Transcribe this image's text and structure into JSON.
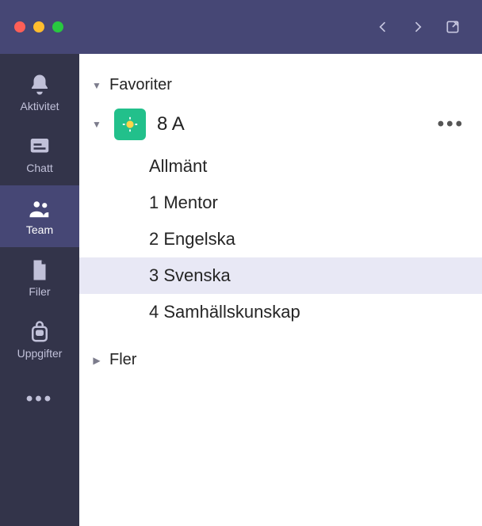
{
  "titlebar": {},
  "rail": {
    "items": [
      {
        "label": "Aktivitet"
      },
      {
        "label": "Chatt"
      },
      {
        "label": "Team"
      },
      {
        "label": "Filer"
      },
      {
        "label": "Uppgifter"
      }
    ]
  },
  "panel": {
    "sections": {
      "favorites": {
        "label": "Favoriter"
      },
      "more": {
        "label": "Fler"
      }
    },
    "team": {
      "name": "8 A",
      "channels": [
        {
          "label": "Allmänt"
        },
        {
          "label": "1 Mentor"
        },
        {
          "label": "2 Engelska"
        },
        {
          "label": "3 Svenska",
          "selected": true
        },
        {
          "label": "4 Samhällskunskap"
        }
      ]
    }
  }
}
